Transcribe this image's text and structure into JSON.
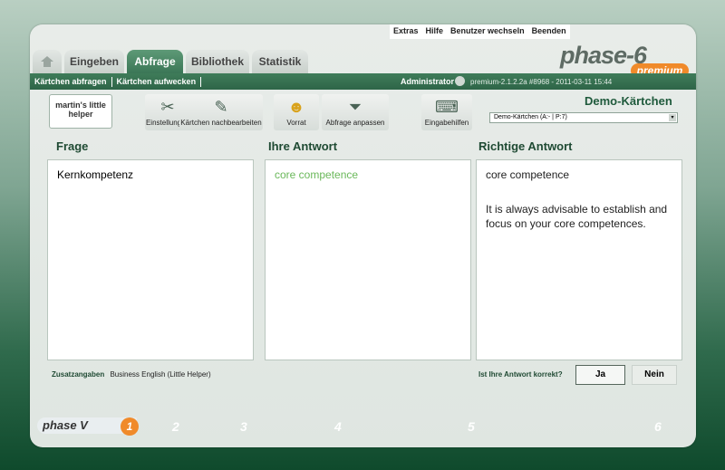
{
  "topmenu": [
    "Extras",
    "Hilfe",
    "Benutzer wechseln",
    "Beenden"
  ],
  "tabs": [
    {
      "label": "Eingeben"
    },
    {
      "label": "Abfrage"
    },
    {
      "label": "Bibliothek"
    },
    {
      "label": "Statistik"
    }
  ],
  "subbar": {
    "links": [
      "Kärtchen abfragen",
      "Kärtchen aufwecken"
    ],
    "user": "Administrator",
    "version": "premium-2.1.2.2a #8968 - 2011-03-11 15:44"
  },
  "logo": {
    "brand": "phase-6",
    "edition": "premium"
  },
  "toolbar": {
    "helper": "martin's little helper",
    "buttons": [
      "Einstellungen",
      "Kärtchen nachbearbeiten",
      "Vorrat",
      "Abfrage anpassen",
      "Eingabehilfen"
    ],
    "deck_title": "Demo-Kärtchen",
    "deck_select": "Demo-Kärtchen (A:- | P:7)"
  },
  "columns": {
    "frage": {
      "title": "Frage",
      "text": "Kernkompetenz"
    },
    "antwort": {
      "title": "Ihre Antwort",
      "text": "core competence"
    },
    "richtig": {
      "title": "Richtige Antwort",
      "line1": "core competence",
      "line2": "It is always advisable to establish and focus on your core competences."
    }
  },
  "bottom": {
    "zusatz_label": "Zusatzangaben",
    "zusatz_value": "Business English (Little Helper)",
    "question": "Ist Ihre Antwort korrekt?",
    "yes": "Ja",
    "no": "Nein"
  },
  "phase": {
    "label": "phase V",
    "active": "1",
    "others": [
      "2",
      "3",
      "4",
      "5",
      "6"
    ]
  },
  "colors": {
    "accent": "#3b7656",
    "orange": "#f08a2a",
    "answer_green": "#6ab85a"
  }
}
